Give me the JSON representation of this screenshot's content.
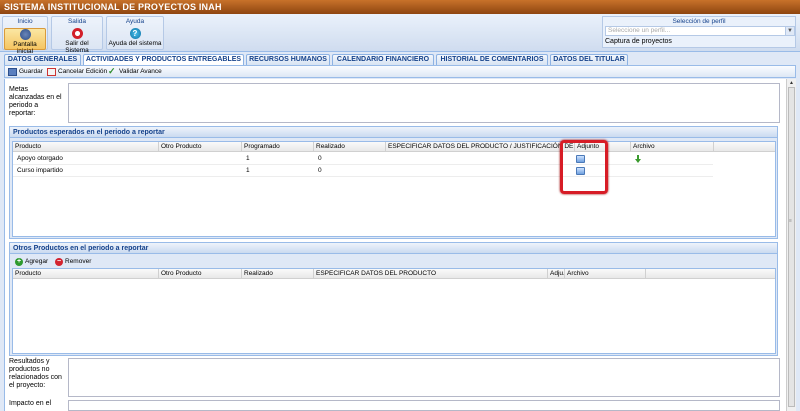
{
  "window_title": "SISTEMA INSTITUCIONAL DE PROYECTOS INAH",
  "ribbon": {
    "groups": [
      {
        "title": "Inicio",
        "button": "Pantalla inicial"
      },
      {
        "title": "Salida",
        "button": "Salir del Sistema"
      },
      {
        "title": "Ayuda",
        "button": "Ayuda del sistema"
      }
    ],
    "perfil": {
      "label": "Selección de perfil",
      "placeholder": "Seleccione un perfil...",
      "current": "Captura de proyectos"
    }
  },
  "tabs": [
    "DATOS GENERALES",
    "ACTIVIDADES Y PRODUCTOS ENTREGABLES",
    "RECURSOS HUMANOS",
    "CALENDARIO FINANCIERO",
    "HISTORIAL DE COMENTARIOS",
    "DATOS DEL TITULAR"
  ],
  "active_tab": "ACTIVIDADES Y PRODUCTOS ENTREGABLES",
  "toolbar": {
    "guardar": "Guardar",
    "cancelar": "Cancelar Edición",
    "validar": "Validar Avance"
  },
  "form": {
    "metas_label": "Metas alcanzadas en el periodo a reportar:",
    "resultados_label": "Resultados y productos no relacionados con el proyecto:",
    "impacto_label": "Impacto en el"
  },
  "productos_esperados": {
    "title": "Productos esperados en el periodo a reportar",
    "columns": [
      "Producto",
      "Otro Producto",
      "Programado",
      "Realizado",
      "ESPECIFICAR DATOS DEL PRODUCTO / JUSTIFICACIÓN DE METAS NO",
      "Adjunto",
      "Archivo"
    ],
    "rows": [
      {
        "producto": "Apoyo otorgado",
        "otro": "",
        "programado": "1",
        "realizado": "0"
      },
      {
        "producto": "Curso impartido",
        "otro": "",
        "programado": "1",
        "realizado": "0"
      }
    ]
  },
  "otros_productos": {
    "title": "Otros Productos en el periodo a reportar",
    "agregar": "Agregar",
    "remover": "Remover",
    "columns": [
      "Producto",
      "Otro Producto",
      "Realizado",
      "ESPECIFICAR DATOS DEL PRODUCTO",
      "Adju.",
      "Archivo"
    ]
  },
  "colors": {
    "title_bar": "#b5621f",
    "highlight": "#d71c26",
    "panel_header": "#15428b"
  }
}
